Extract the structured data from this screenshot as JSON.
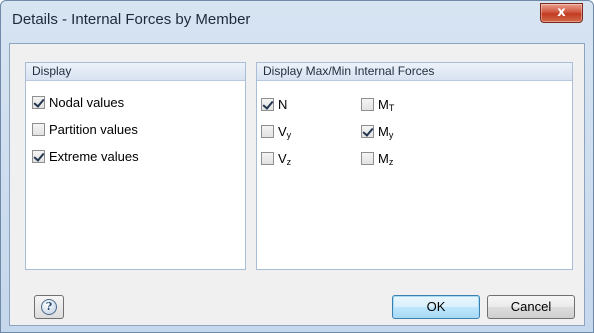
{
  "window": {
    "title": "Details - Internal Forces by Member",
    "close_glyph": "x"
  },
  "display_panel": {
    "header": "Display",
    "options": [
      {
        "label": "Nodal values",
        "checked": true
      },
      {
        "label": "Partition values",
        "checked": false
      },
      {
        "label": "Extreme values",
        "checked": true
      }
    ]
  },
  "maxmin_panel": {
    "header": "Display Max/Min Internal Forces",
    "forces": [
      {
        "symbol": "N",
        "sub": "",
        "checked": true
      },
      {
        "symbol": "V",
        "sub": "y",
        "checked": false
      },
      {
        "symbol": "V",
        "sub": "z",
        "checked": false
      },
      {
        "symbol": "M",
        "sub": "T",
        "checked": false
      },
      {
        "symbol": "M",
        "sub": "y",
        "checked": true
      },
      {
        "symbol": "M",
        "sub": "z",
        "checked": false
      }
    ]
  },
  "buttons": {
    "help_glyph": "?",
    "ok": "OK",
    "cancel": "Cancel"
  },
  "colors": {
    "frame": "#c5d7ec",
    "close_button": "#c13b22",
    "ok_button": "#bee6fd",
    "panel_header": "#d7e2f1"
  }
}
